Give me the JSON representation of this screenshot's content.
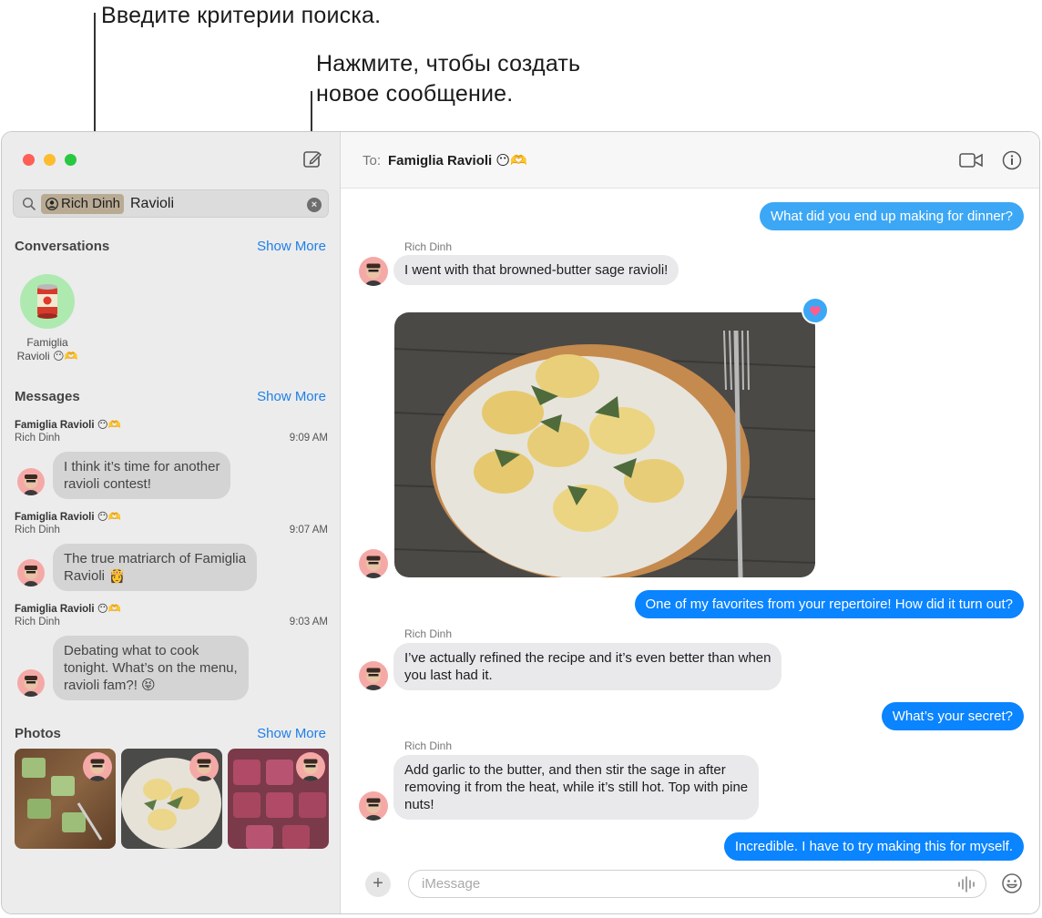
{
  "callouts": {
    "search": "Введите критерии поиска.",
    "compose_line1": "Нажмите, чтобы создать",
    "compose_line2": "новое сообщение."
  },
  "sidebar": {
    "search": {
      "token": "Rich Dinh",
      "term": "Ravioli"
    },
    "conversations": {
      "title": "Conversations",
      "show_more": "Show More",
      "items": [
        {
          "name_line1": "Famiglia",
          "name_line2": "Ravioli 😶🫶"
        }
      ]
    },
    "messages": {
      "title": "Messages",
      "show_more": "Show More",
      "items": [
        {
          "group": "Famiglia Ravioli 😶🫶",
          "sender": "Rich Dinh",
          "time": "9:09 AM",
          "line1": "I think it’s time for another",
          "line2": "ravioli contest!",
          "line3": ""
        },
        {
          "group": "Famiglia Ravioli 😶🫶",
          "sender": "Rich Dinh",
          "time": "9:07 AM",
          "line1": "The true matriarch of Famiglia",
          "line2": "Ravioli 👸",
          "line3": ""
        },
        {
          "group": "Famiglia Ravioli 😶🫶",
          "sender": "Rich Dinh",
          "time": "9:03 AM",
          "line1": "Debating what to cook",
          "line2": "tonight. What’s on the menu,",
          "line3": "ravioli fam?! 😝"
        }
      ]
    },
    "photos": {
      "title": "Photos",
      "show_more": "Show More"
    }
  },
  "chat": {
    "to_label": "To:",
    "to_name": "Famiglia Ravioli 😶🫶",
    "messages": [
      {
        "dir": "out",
        "text": "What did you end up making for dinner?"
      },
      {
        "dir": "in",
        "sender": "Rich Dinh",
        "text": "I went with that browned-butter sage ravioli!"
      },
      {
        "dir": "out",
        "text": "One of my favorites from your repertoire! How did it turn out?"
      },
      {
        "dir": "in",
        "sender": "Rich Dinh",
        "line1": "I’ve actually refined the recipe and it’s even better than when",
        "line2": "you last had it."
      },
      {
        "dir": "out",
        "text": "What’s your secret?"
      },
      {
        "dir": "in",
        "sender": "Rich Dinh",
        "line1": "Add garlic to the butter, and then stir the sage in after",
        "line2": "removing it from the heat, while it’s still hot. Top with pine",
        "line3": "nuts!"
      },
      {
        "dir": "out",
        "text": "Incredible. I have to try making this for myself."
      }
    ],
    "composer_placeholder": "iMessage"
  },
  "colors": {
    "accent": "#0a84ff",
    "link": "#1f7fe8",
    "bubble_in": "#e9e9eb",
    "sidebar_bg": "#ececec"
  },
  "icons": [
    "search-icon",
    "compose-icon",
    "clear-icon",
    "video-icon",
    "info-icon",
    "plus-icon",
    "waveform-icon",
    "emoji-icon",
    "heart-icon"
  ]
}
